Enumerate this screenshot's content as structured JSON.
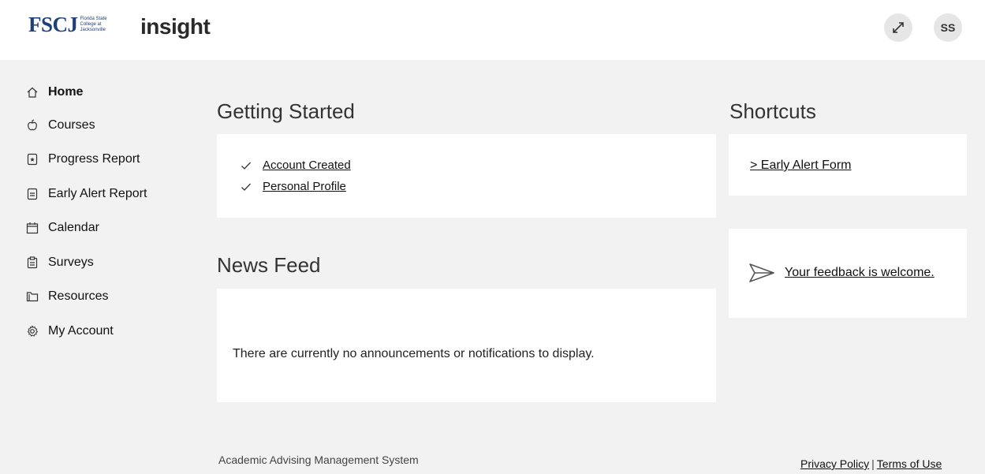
{
  "header": {
    "college_logo_text": "FSCJ",
    "college_logo_subtext": "Florida State College at Jacksonville",
    "app_logo_text": "insight",
    "avatar_initials": "SS",
    "expand_icon": "expand-icon"
  },
  "sidebar": {
    "items": [
      {
        "label": "Home",
        "icon": "home-icon"
      },
      {
        "label": "Courses",
        "icon": "apple-icon"
      },
      {
        "label": "Progress Report",
        "icon": "star-document-icon"
      },
      {
        "label": "Early Alert Report",
        "icon": "document-icon"
      },
      {
        "label": "Calendar",
        "icon": "calendar-icon"
      },
      {
        "label": "Surveys",
        "icon": "clipboard-icon"
      },
      {
        "label": "Resources",
        "icon": "folder-icon"
      },
      {
        "label": "My Account",
        "icon": "gear-icon"
      }
    ]
  },
  "getting_started": {
    "title": "Getting Started",
    "items": [
      {
        "label": "Account Created"
      },
      {
        "label": "Personal Profile"
      }
    ]
  },
  "news_feed": {
    "title": "News Feed",
    "empty_message": "There are currently no announcements or notifications to display."
  },
  "shortcuts": {
    "title": "Shortcuts",
    "links": [
      {
        "label": "> Early Alert Form"
      }
    ]
  },
  "feedback": {
    "label": "Your feedback is welcome.",
    "icon": "send-icon"
  },
  "footer": {
    "system_name": "Academic Advising Management System",
    "privacy_label": "Privacy Policy",
    "separator": "|",
    "terms_label": "Terms of Use"
  },
  "colors": {
    "brand_blue": "#1f3f78",
    "background": "#f2f2f2",
    "card": "#ffffff"
  }
}
